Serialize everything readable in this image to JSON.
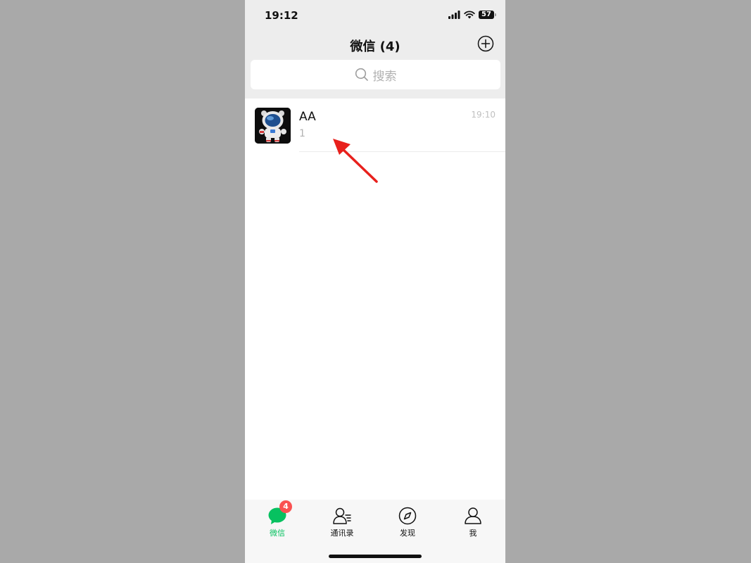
{
  "status_bar": {
    "time": "19:12",
    "battery": "57",
    "icons": [
      "signal-icon",
      "wifi-icon",
      "battery-icon"
    ]
  },
  "header": {
    "title": "微信 (4)",
    "add_icon": "plus-circle-icon"
  },
  "search": {
    "placeholder": "搜索",
    "icon": "search-icon"
  },
  "chats": [
    {
      "name": "AA",
      "preview": "1",
      "time": "19:10",
      "avatar": "astronaut-avatar"
    }
  ],
  "tab_bar": {
    "tabs": [
      {
        "label": "微信",
        "icon": "chat-bubble-icon",
        "active": true,
        "badge": "4"
      },
      {
        "label": "通讯录",
        "icon": "contacts-icon",
        "active": false
      },
      {
        "label": "发现",
        "icon": "compass-icon",
        "active": false
      },
      {
        "label": "我",
        "icon": "person-icon",
        "active": false
      }
    ]
  },
  "colors": {
    "header_bg": "#ededed",
    "accent": "#07c160",
    "badge": "#fa5151",
    "annotation_arrow": "#e8201c"
  }
}
